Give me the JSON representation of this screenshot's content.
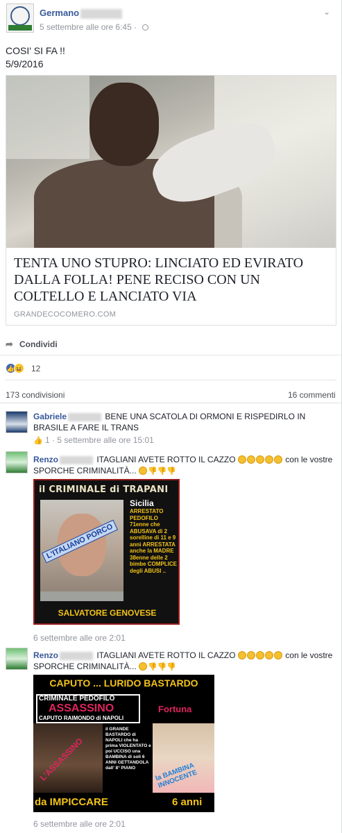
{
  "post": {
    "author_first": "Germano",
    "timestamp": "5 settembre alle ore 6:45 · ",
    "text_line1": "COSI' SI FA !!",
    "text_line2": "5/9/2016"
  },
  "link": {
    "title": "TENTA UNO STUPRO: LINCIATO ED EVIRATO DALLA FOLLA! PENE RECISO CON UN COLTELLO E LANCIATO VIA",
    "domain": "GRANDECOCOMERO.COM"
  },
  "actions": {
    "share_label": "Condividi"
  },
  "reactions": {
    "count": "12"
  },
  "stats": {
    "shares": "173 condivisioni",
    "comments": "16 commenti"
  },
  "comments": [
    {
      "name": "Gabriele",
      "text_line1": "BENE UNA SCATOLA DI ORMONI E RISPEDIRLO IN",
      "text_line2": "BRASILE A FARE IL TRANS",
      "likes": "1",
      "meta": " · 5 settembre alle ore 15:01"
    },
    {
      "name": "Renzo",
      "text_line1": "ITAGLIANI AVETE ROTTO IL CAZZO",
      "text_line1_end": "con le vostre",
      "text_line2": "SPORCHE CRIMINALITÀ...",
      "meta": "6 settembre alle ore 2:01",
      "image": {
        "title": "il CRIMINALE di TRAPANI",
        "label": "L'ITALIANO PORCO",
        "region": "Sicilia",
        "desc": "ARRESTATO PEDOFILO 71enne che ABUSAVA di 2 sorelline di 11 e 9 anni ARRESTATA anche la MADRE 38enne delle 2 bimbe COMPLICE degli ABUSI ..",
        "name": "SALVATORE GENOVESE"
      }
    },
    {
      "name": "Renzo",
      "text_line1": "ITAGLIANI AVETE ROTTO IL CAZZO",
      "text_line1_end": "con le vostre",
      "text_line2": "SPORCHE CRIMINALITÀ...",
      "meta": "6 settembre alle ore 2:01",
      "image": {
        "top": "CAPUTO ... LURIDO BASTARDO",
        "sub": "CRIMINALE  PEDOFILO",
        "big": "ASSASSINO",
        "small": "CAPUTO RAIMONDO di NAPOLI",
        "victim_name": "Fortuna",
        "desc": "il GRANDE BASTARDO di NAPOLI che ha prima VIOLENTATO e poi UCCISO una BAMBINA di soli 6 ANNI GETTANDOLA dall' 8° PIANO",
        "left_label": "L'ASSASSINO",
        "right_label": "la BAMBINA INNOCENTE",
        "bottom_left": "da IMPICCARE",
        "bottom_right": "6 anni"
      }
    }
  ]
}
